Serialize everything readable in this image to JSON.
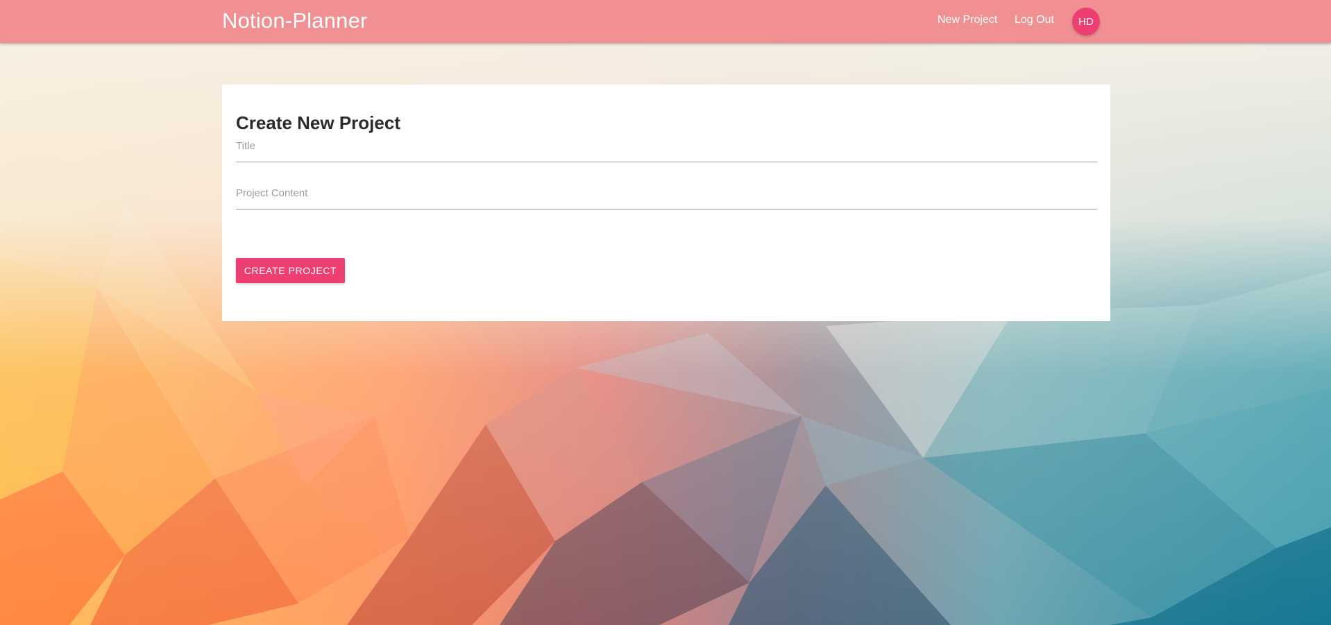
{
  "navbar": {
    "brand": "Notion-Planner",
    "new_project": "New Project",
    "log_out": "Log Out",
    "avatar_initials": "HD"
  },
  "form": {
    "title": "Create New Project",
    "title_field_label": "Title",
    "content_field_label": "Project Content",
    "submit_label": "CREATE PROJECT"
  },
  "colors": {
    "navbar": "#f09092",
    "accent": "#ee3f73",
    "card": "#ffffff"
  }
}
